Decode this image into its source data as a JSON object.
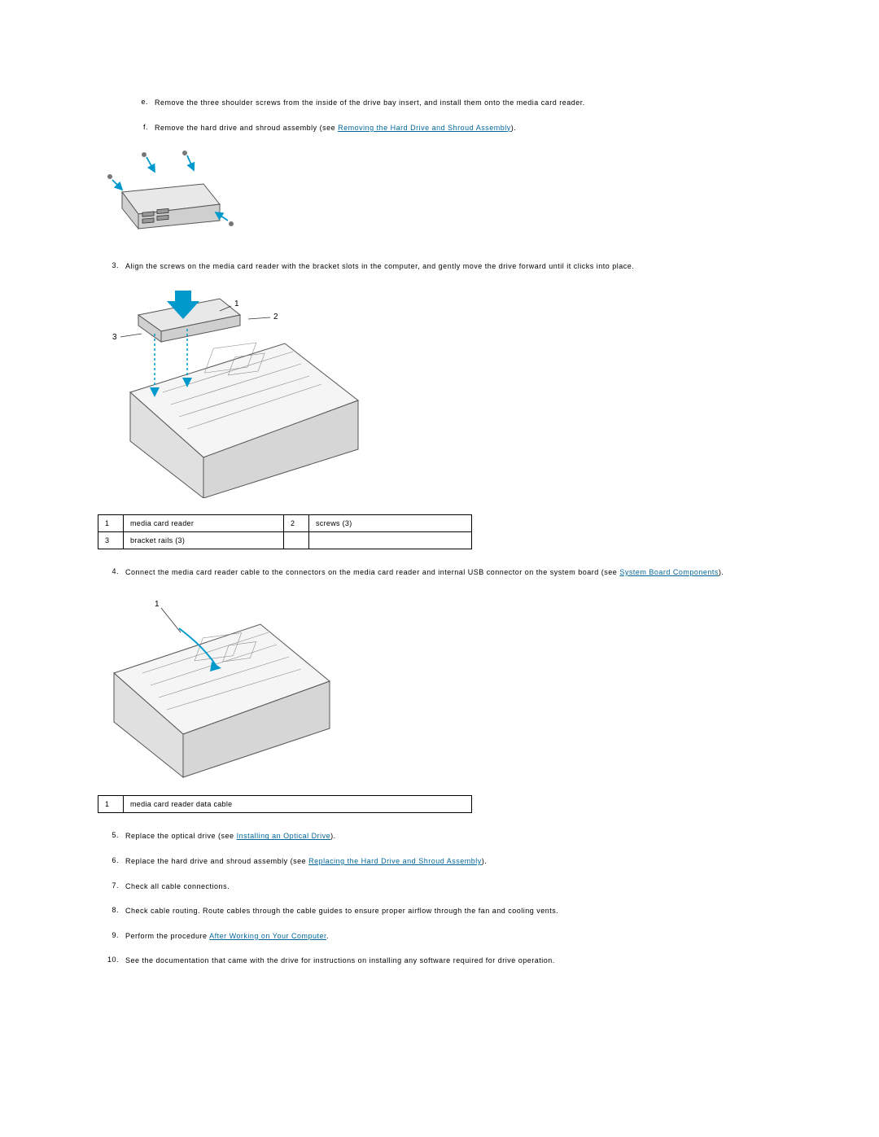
{
  "steps_alpha": [
    {
      "marker": "e.",
      "text": "Remove the three shoulder screws from the inside of the drive bay insert, and install them onto the media card reader."
    },
    {
      "marker": "f.",
      "pre": "Remove the hard drive and shroud assembly (see ",
      "link": "Removing the Hard Drive and Shroud Assembly",
      "post": ")."
    }
  ],
  "step3": {
    "marker": "3.",
    "text": "Align the screws on the media card reader with the bracket slots in the computer, and gently move the drive forward until it clicks into place."
  },
  "table1": {
    "r1c1": "1",
    "r1c2": "media card reader",
    "r1c3": "2",
    "r1c4": "screws (3)",
    "r2c1": "3",
    "r2c2": "bracket rails (3)",
    "r2c3": "",
    "r2c4": ""
  },
  "step4": {
    "marker": "4.",
    "pre": "Connect the media card reader cable to the connectors on the media card reader and internal USB connector on the system board (see ",
    "link": "System Board Components",
    "post": ")."
  },
  "table2": {
    "r1c1": "1",
    "r1c2": "media card reader data cable"
  },
  "steps_num": [
    {
      "marker": "5.",
      "pre": "Replace the optical drive (see ",
      "link": "Installing an Optical Drive",
      "post": ")."
    },
    {
      "marker": "6.",
      "pre": "Replace the hard drive and shroud assembly (see ",
      "link": "Replacing the Hard Drive and Shroud Assembly",
      "post": ")."
    },
    {
      "marker": "7.",
      "text": "Check all cable connections."
    },
    {
      "marker": "8.",
      "text": "Check cable routing. Route cables through the cable guides to ensure proper airflow through the fan and cooling vents."
    },
    {
      "marker": "9.",
      "pre": "Perform the procedure ",
      "link": "After Working on Your Computer",
      "post": "."
    },
    {
      "marker": "10.",
      "text": "See the documentation that came with the drive for instructions on installing any software required for drive operation."
    }
  ],
  "callouts_fig2": {
    "c1": "1",
    "c2": "2",
    "c3": "3"
  },
  "callouts_fig3": {
    "c1": "1"
  }
}
